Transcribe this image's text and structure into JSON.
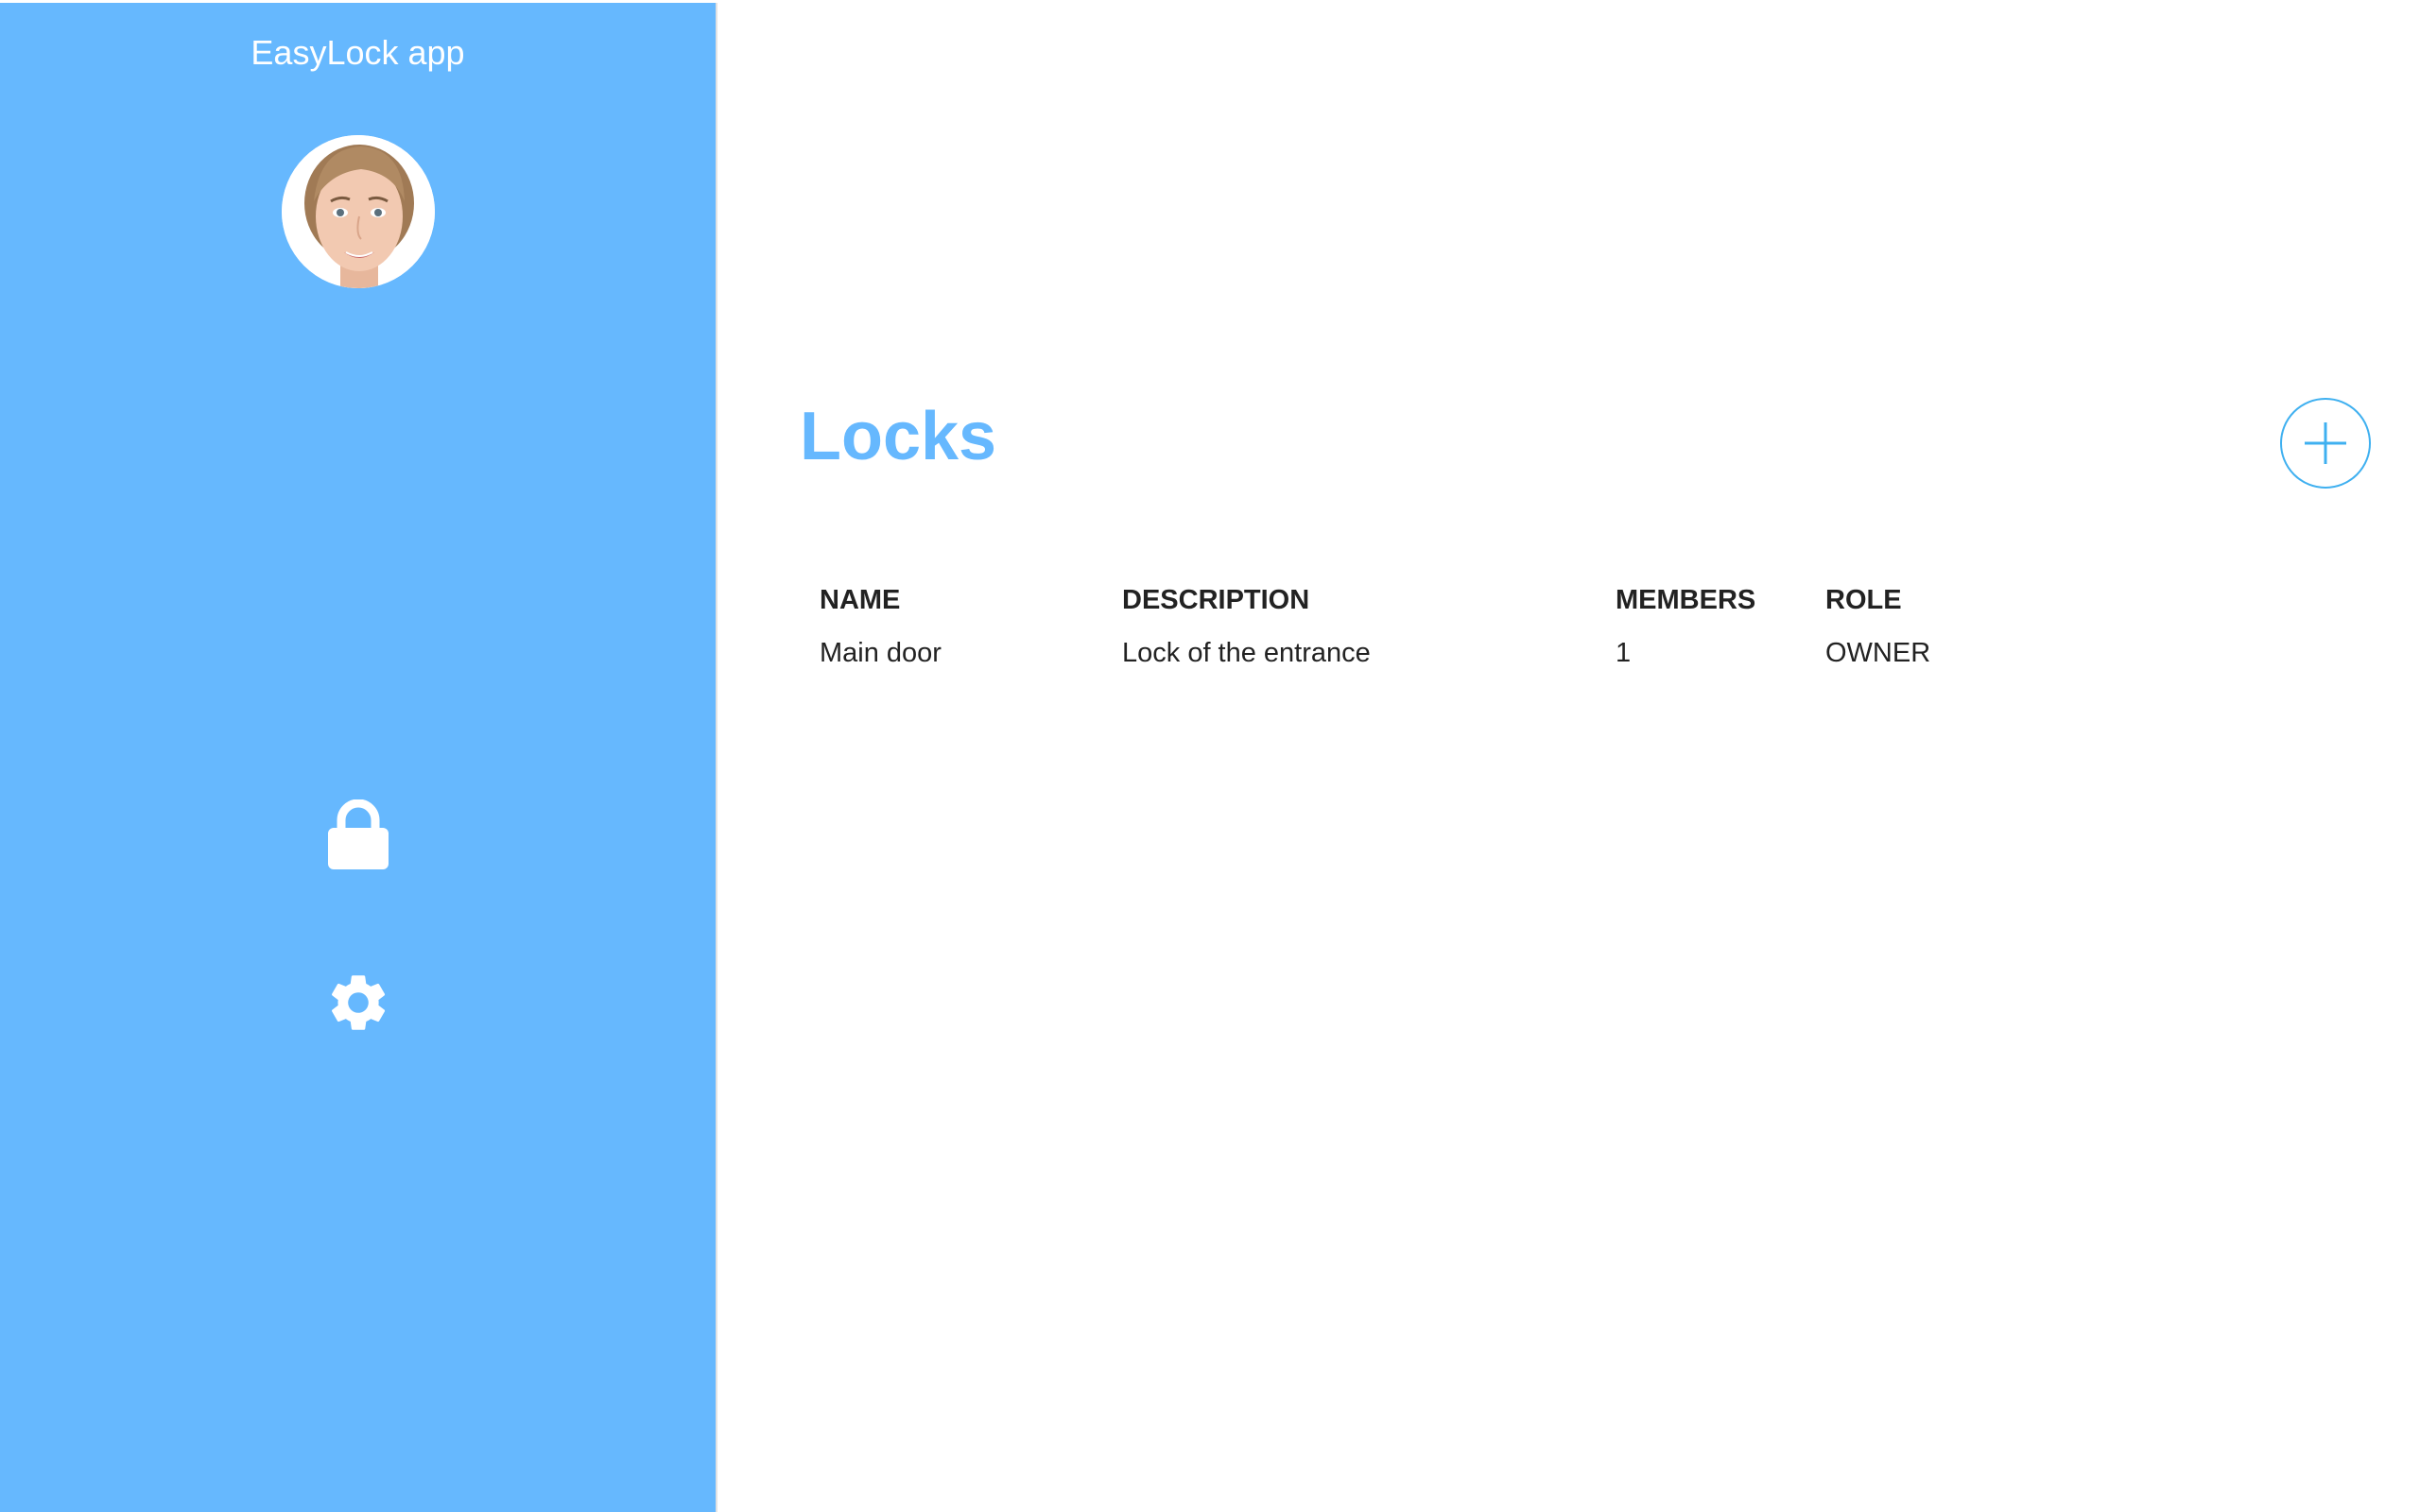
{
  "app": {
    "title": "EasyLock app"
  },
  "sidebar": {
    "avatar_alt": "User avatar",
    "nav": [
      {
        "icon": "lock-icon"
      },
      {
        "icon": "gear-icon"
      }
    ]
  },
  "main": {
    "title": "Locks",
    "add_icon": "plus-icon",
    "table": {
      "headers": [
        "NAME",
        "DESCRIPTION",
        "MEMBERS",
        "ROLE"
      ],
      "rows": [
        [
          "Main door",
          "Lock of the entrance",
          "1",
          "OWNER"
        ]
      ]
    }
  },
  "colors": {
    "sidebar": "#66b8fe",
    "title": "#66b8fe",
    "add_button_accent": "#3fb0f0",
    "text": "#222222"
  }
}
